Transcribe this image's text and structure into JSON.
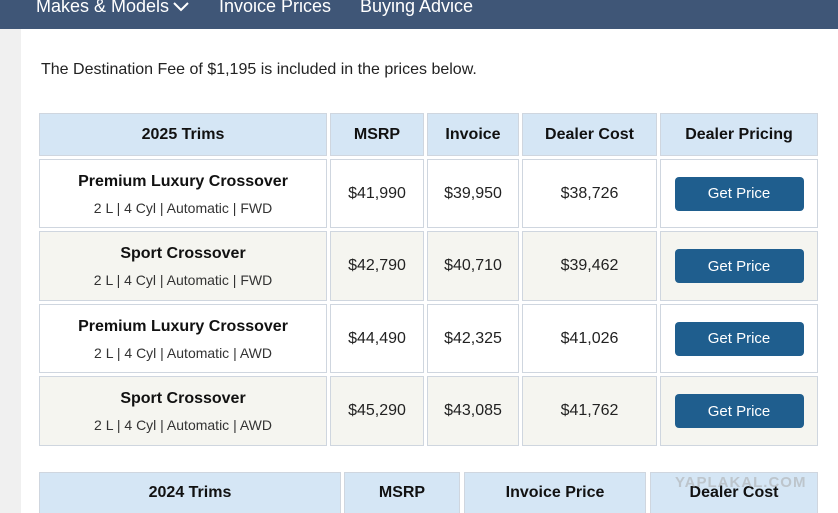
{
  "nav": {
    "makes_models": "Makes & Models",
    "invoice_prices": "Invoice Prices",
    "buying_advice": "Buying Advice"
  },
  "fee_note": "The Destination Fee of $1,195 is included in the prices below.",
  "table_2025": {
    "headers": [
      "2025 Trims",
      "MSRP",
      "Invoice",
      "Dealer Cost",
      "Dealer Pricing"
    ],
    "rows": [
      {
        "trim": "Premium Luxury Crossover",
        "spec": "2 L | 4 Cyl | Automatic | FWD",
        "msrp": "$41,990",
        "invoice": "$39,950",
        "dealer_cost": "$38,726",
        "button": "Get Price"
      },
      {
        "trim": "Sport Crossover",
        "spec": "2 L | 4 Cyl | Automatic | FWD",
        "msrp": "$42,790",
        "invoice": "$40,710",
        "dealer_cost": "$39,462",
        "button": "Get Price"
      },
      {
        "trim": "Premium Luxury Crossover",
        "spec": "2 L | 4 Cyl | Automatic | AWD",
        "msrp": "$44,490",
        "invoice": "$42,325",
        "dealer_cost": "$41,026",
        "button": "Get Price"
      },
      {
        "trim": "Sport Crossover",
        "spec": "2 L | 4 Cyl | Automatic | AWD",
        "msrp": "$45,290",
        "invoice": "$43,085",
        "dealer_cost": "$41,762",
        "button": "Get Price"
      }
    ]
  },
  "table_2024": {
    "headers": [
      "2024 Trims",
      "MSRP",
      "Invoice Price",
      "Dealer Cost"
    ]
  },
  "watermark": "YAPLAKAL.COM"
}
